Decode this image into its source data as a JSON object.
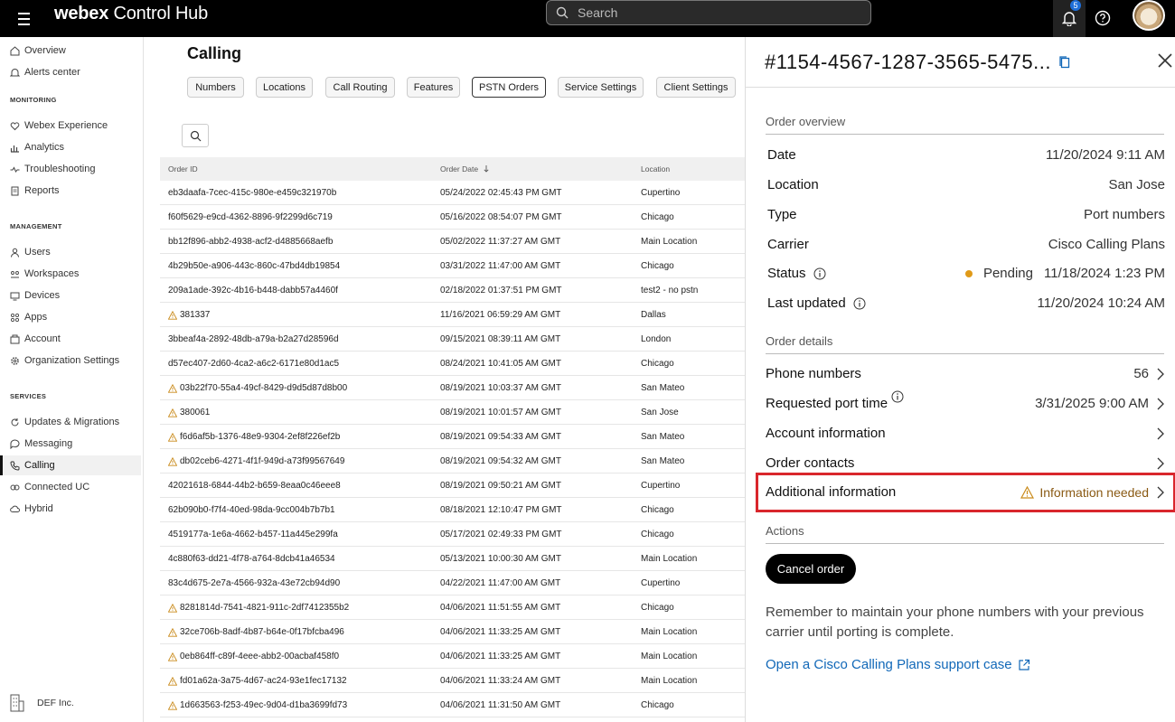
{
  "header": {
    "brand_bold": "webex",
    "brand_rest": " Control Hub",
    "search_placeholder": "Search",
    "notification_count": "5"
  },
  "sidebar": {
    "top_items": [
      {
        "label": "Overview",
        "icon": "home-icon"
      },
      {
        "label": "Alerts center",
        "icon": "bell-icon"
      }
    ],
    "monitoring_heading": "MONITORING",
    "monitoring_items": [
      {
        "label": "Webex Experience",
        "icon": "heart-icon"
      },
      {
        "label": "Analytics",
        "icon": "bar-chart-icon"
      },
      {
        "label": "Troubleshooting",
        "icon": "pulse-icon"
      },
      {
        "label": "Reports",
        "icon": "report-icon"
      }
    ],
    "management_heading": "MANAGEMENT",
    "management_items": [
      {
        "label": "Users",
        "icon": "user-icon"
      },
      {
        "label": "Workspaces",
        "icon": "workspaces-icon"
      },
      {
        "label": "Devices",
        "icon": "device-icon"
      },
      {
        "label": "Apps",
        "icon": "apps-icon"
      },
      {
        "label": "Account",
        "icon": "account-icon"
      },
      {
        "label": "Organization Settings",
        "icon": "gear-icon"
      }
    ],
    "services_heading": "SERVICES",
    "services_items": [
      {
        "label": "Updates & Migrations",
        "icon": "refresh-icon"
      },
      {
        "label": "Messaging",
        "icon": "chat-icon"
      },
      {
        "label": "Calling",
        "icon": "phone-icon",
        "active": true
      },
      {
        "label": "Connected UC",
        "icon": "connected-icon"
      },
      {
        "label": "Hybrid",
        "icon": "cloud-icon"
      }
    ],
    "org_name": "DEF Inc."
  },
  "main": {
    "title": "Calling",
    "tabs": [
      {
        "label": "Numbers"
      },
      {
        "label": "Locations"
      },
      {
        "label": "Call Routing"
      },
      {
        "label": "Features"
      },
      {
        "label": "PSTN Orders",
        "active": true
      },
      {
        "label": "Service Settings"
      },
      {
        "label": "Client Settings"
      }
    ],
    "columns": {
      "order_id": "Order ID",
      "order_date": "Order Date",
      "location": "Location"
    },
    "rows": [
      {
        "id": "eb3daafa-7cec-415c-980e-e459c321970b",
        "date": "05/24/2022 02:45:43 PM GMT",
        "location": "Cupertino",
        "warn": false
      },
      {
        "id": "f60f5629-e9cd-4362-8896-9f2299d6c719",
        "date": "05/16/2022 08:54:07 PM GMT",
        "location": "Chicago",
        "warn": false
      },
      {
        "id": "bb12f896-abb2-4938-acf2-d4885668aefb",
        "date": "05/02/2022 11:37:27 AM GMT",
        "location": "Main Location",
        "warn": false
      },
      {
        "id": "4b29b50e-a906-443c-860c-47bd4db19854",
        "date": "03/31/2022 11:47:00 AM GMT",
        "location": "Chicago",
        "warn": false
      },
      {
        "id": "209a1ade-392c-4b16-b448-dabb57a4460f",
        "date": "02/18/2022 01:37:51 PM GMT",
        "location": "test2 - no pstn",
        "warn": false
      },
      {
        "id": "381337",
        "date": "11/16/2021 06:59:29 AM GMT",
        "location": "Dallas",
        "warn": true
      },
      {
        "id": "3bbeaf4a-2892-48db-a79a-b2a27d28596d",
        "date": "09/15/2021 08:39:11 AM GMT",
        "location": "London",
        "warn": false
      },
      {
        "id": "d57ec407-2d60-4ca2-a6c2-6171e80d1ac5",
        "date": "08/24/2021 10:41:05 AM GMT",
        "location": "Chicago",
        "warn": false
      },
      {
        "id": "03b22f70-55a4-49cf-8429-d9d5d87d8b00",
        "date": "08/19/2021 10:03:37 AM GMT",
        "location": "San Mateo",
        "warn": true
      },
      {
        "id": "380061",
        "date": "08/19/2021 10:01:57 AM GMT",
        "location": "San Jose",
        "warn": true
      },
      {
        "id": "f6d6af5b-1376-48e9-9304-2ef8f226ef2b",
        "date": "08/19/2021 09:54:33 AM GMT",
        "location": "San Mateo",
        "warn": true
      },
      {
        "id": "db02ceb6-4271-4f1f-949d-a73f99567649",
        "date": "08/19/2021 09:54:32 AM GMT",
        "location": "San Mateo",
        "warn": true
      },
      {
        "id": "42021618-6844-44b2-b659-8eaa0c46eee8",
        "date": "08/19/2021 09:50:21 AM GMT",
        "location": "Cupertino",
        "warn": false
      },
      {
        "id": "62b090b0-f7f4-40ed-98da-9cc004b7b7b1",
        "date": "08/18/2021 12:10:47 PM GMT",
        "location": "Chicago",
        "warn": false
      },
      {
        "id": "4519177a-1e6a-4662-b457-11a445e299fa",
        "date": "05/17/2021 02:49:33 PM GMT",
        "location": "Chicago",
        "warn": false
      },
      {
        "id": "4c880f63-dd21-4f78-a764-8dcb41a46534",
        "date": "05/13/2021 10:00:30 AM GMT",
        "location": "Main Location",
        "warn": false
      },
      {
        "id": "83c4d675-2e7a-4566-932a-43e72cb94d90",
        "date": "04/22/2021 11:47:00 AM GMT",
        "location": "Cupertino",
        "warn": false
      },
      {
        "id": "8281814d-7541-4821-911c-2df7412355b2",
        "date": "04/06/2021 11:51:55 AM GMT",
        "location": "Chicago",
        "warn": true
      },
      {
        "id": "32ce706b-8adf-4b87-b64e-0f17bfcba496",
        "date": "04/06/2021 11:33:25 AM GMT",
        "location": "Main Location",
        "warn": true
      },
      {
        "id": "0eb864ff-c89f-4eee-abb2-00acbaf458f0",
        "date": "04/06/2021 11:33:25 AM GMT",
        "location": "Main Location",
        "warn": true
      },
      {
        "id": "fd01a62a-3a75-4d67-ac24-93e1fec17132",
        "date": "04/06/2021 11:33:24 AM GMT",
        "location": "Main Location",
        "warn": true
      },
      {
        "id": "1d663563-f253-49ec-9d04-d1ba3699fd73",
        "date": "04/06/2021 11:31:50 AM GMT",
        "location": "Chicago",
        "warn": true
      }
    ]
  },
  "panel": {
    "title": "#1154-4567-1287-3565-5475...",
    "overview_heading": "Order overview",
    "overview": [
      {
        "key": "Date",
        "value": "11/20/2024 9:11 AM"
      },
      {
        "key": "Location",
        "value": "San Jose"
      },
      {
        "key": "Type",
        "value": "Port numbers"
      },
      {
        "key": "Carrier",
        "value": "Cisco Calling Plans"
      }
    ],
    "status_label": "Status",
    "status_value": "Pending",
    "status_time": "11/18/2024 1:23 PM",
    "last_updated_label": "Last updated",
    "last_updated_value": "11/20/2024 10:24 AM",
    "details_heading": "Order details",
    "phone_numbers_label": "Phone numbers",
    "phone_numbers_value": "56",
    "port_time_label": "Requested port time",
    "port_time_value": "3/31/2025 9:00 AM",
    "account_info_label": "Account information",
    "order_contacts_label": "Order contacts",
    "additional_info_label": "Additional information",
    "additional_info_value": "Information needed",
    "actions_heading": "Actions",
    "cancel_label": "Cancel order",
    "note": "Remember to maintain your phone numbers with your previous carrier until porting is complete.",
    "support_link": "Open a Cisco Calling Plans support case"
  },
  "colors": {
    "accent_link": "#1168b8",
    "pending": "#e09a18",
    "warning": "#c98a1a",
    "highlight": "#d9262c"
  }
}
